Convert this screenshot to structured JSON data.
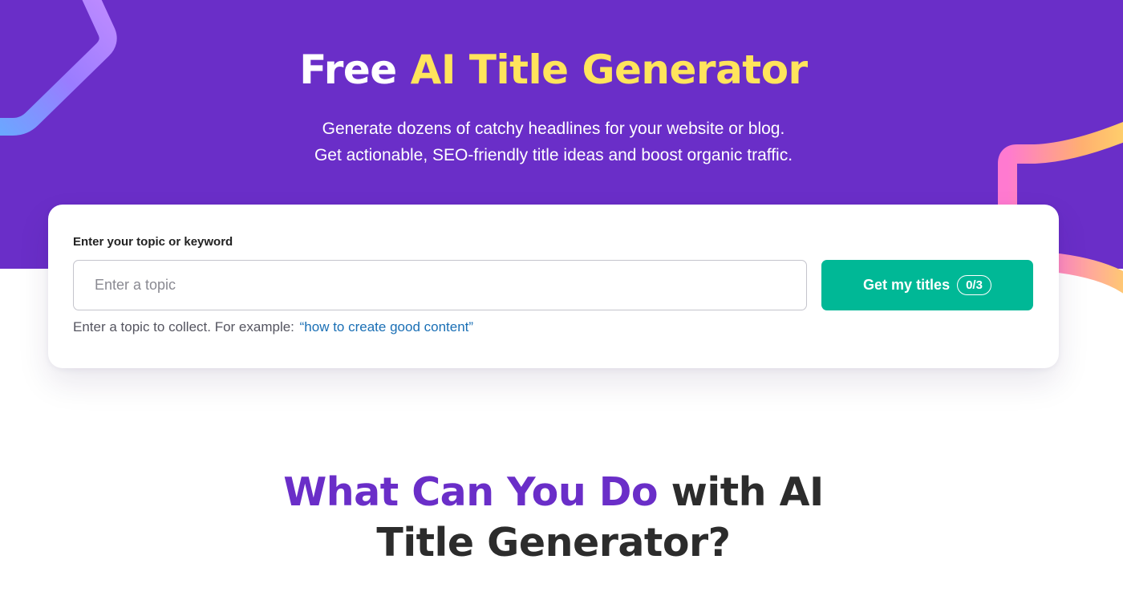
{
  "hero": {
    "title_plain": "Free ",
    "title_accent": "AI Title Generator",
    "subtitle_line1": "Generate dozens of catchy headlines for your website or blog.",
    "subtitle_line2": "Get actionable, SEO-friendly title ideas and boost organic traffic."
  },
  "form": {
    "label": "Enter your topic or keyword",
    "input_value": "",
    "input_placeholder": "Enter a topic",
    "button_label": "Get my titles",
    "usage_counter": "0/3",
    "hint_text": "Enter a topic to collect. For example:",
    "example_link": "“how to create good content”"
  },
  "section": {
    "title_accent": "What Can You Do",
    "title_rest": " with AI",
    "title_line2": "Title Generator?"
  },
  "colors": {
    "hero_background": "#6a2ec8",
    "title_accent": "#ffe45c",
    "button_background": "#00b896",
    "link": "#1a6fb5",
    "section_accent": "#6a2ec8"
  },
  "icons": {
    "decorations": [
      "gradient-ribbon-top-left",
      "gradient-ribbon-right"
    ]
  }
}
